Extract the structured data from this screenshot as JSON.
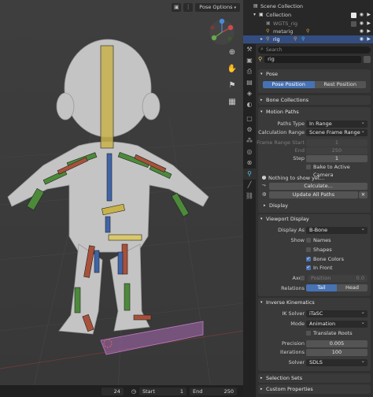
{
  "viewport": {
    "pose_options": "Pose Options",
    "frame": "24",
    "start_label": "Start",
    "start_value": "1",
    "end_label": "End",
    "end_value": "250"
  },
  "outliner": {
    "rows": [
      {
        "label": "Scene Collection"
      },
      {
        "label": "Collection"
      },
      {
        "label": "WGTS_rig"
      },
      {
        "label": "metarig"
      },
      {
        "label": "rig"
      }
    ]
  },
  "properties": {
    "search_placeholder": "Search",
    "context": "rig",
    "pose": {
      "title": "Pose",
      "pose_position": "Pose Position",
      "rest_position": "Rest Position"
    },
    "bone_collections": "Bone Collections",
    "motion_paths": {
      "title": "Motion Paths",
      "paths_type_label": "Paths Type",
      "paths_type_value": "In Range",
      "calc_range_label": "Calculation Range",
      "calc_range_value": "Scene Frame Range",
      "frame_range_start_label": "Frame Range Start",
      "frame_range_start_value": "1",
      "end_label": "End",
      "end_value": "250",
      "step_label": "Step",
      "step_value": "1",
      "bake_label": "Bake to Active Camera",
      "nothing_msg": "Nothing to show yet...",
      "calculate_btn": "Calculate...",
      "update_all_btn": "Update All Paths",
      "display_sub": "Display"
    },
    "viewport_display": {
      "title": "Viewport Display",
      "display_as_label": "Display As",
      "display_as_value": "B-Bone",
      "show_label": "Show",
      "names": "Names",
      "shapes": "Shapes",
      "bone_colors": "Bone Colors",
      "in_front": "In Front",
      "axes_label": "Axes",
      "position_label": "Position",
      "position_value": "0.0",
      "relations_label": "Relations",
      "tail": "Tail",
      "head": "Head"
    },
    "ik": {
      "title": "Inverse Kinematics",
      "ik_solver_label": "IK Solver",
      "ik_solver_value": "iTaSC",
      "mode_label": "Mode",
      "mode_value": "Animation",
      "translate_roots": "Translate Roots",
      "precision_label": "Precision",
      "precision_value": "0.005",
      "iterations_label": "Iterations",
      "iterations_value": "100",
      "solver_label": "Solver",
      "solver_value": "SDLS"
    },
    "selection_sets": "Selection Sets",
    "custom_properties": "Custom Properties"
  },
  "colors": {
    "accent_blue": "#4772b3",
    "selected_row": "#334d80",
    "bone_yellow": "#c8b24a",
    "bone_green": "#4c8a3a",
    "bone_red": "#a8513a",
    "bone_blue": "#3f64a8"
  }
}
